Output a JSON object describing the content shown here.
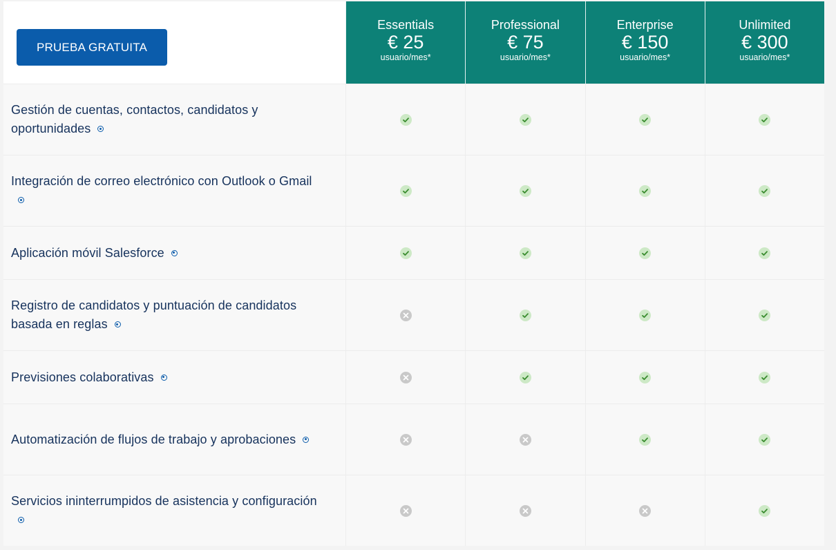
{
  "trial_button": "PRUEBA GRATUITA",
  "plans": [
    {
      "name": "Essentials",
      "price": "€ 25",
      "unit": "usuario/mes*"
    },
    {
      "name": "Professional",
      "price": "€ 75",
      "unit": "usuario/mes*"
    },
    {
      "name": "Enterprise",
      "price": "€ 150",
      "unit": "usuario/mes*"
    },
    {
      "name": "Unlimited",
      "price": "€ 300",
      "unit": "usuario/mes*"
    }
  ],
  "features": [
    {
      "label": "Gestión de cuentas, contactos, candidatos y oportunidades",
      "support": [
        true,
        true,
        true,
        true
      ]
    },
    {
      "label": "Integración de correo electrónico con Outlook o Gmail",
      "support": [
        true,
        true,
        true,
        true
      ]
    },
    {
      "label": "Aplicación móvil Salesforce",
      "support": [
        true,
        true,
        true,
        true
      ]
    },
    {
      "label": "Registro de candidatos y puntuación de candidatos basada en reglas",
      "support": [
        false,
        true,
        true,
        true
      ]
    },
    {
      "label": "Previsiones colaborativas",
      "support": [
        false,
        true,
        true,
        true
      ]
    },
    {
      "label": "Automatización de flujos de trabajo y aprobaciones",
      "support": [
        false,
        false,
        true,
        true
      ]
    },
    {
      "label": "Servicios ininterrumpidos de asistencia y configuración",
      "support": [
        false,
        false,
        false,
        true
      ]
    }
  ],
  "icons": {
    "included": "check-icon",
    "excluded": "cross-icon",
    "info": "info-icon"
  },
  "colors": {
    "header": "#0d8177",
    "button": "#0b5cab",
    "text": "#16325c",
    "included": "#cde9c6",
    "excluded": "#c9c9c9"
  }
}
